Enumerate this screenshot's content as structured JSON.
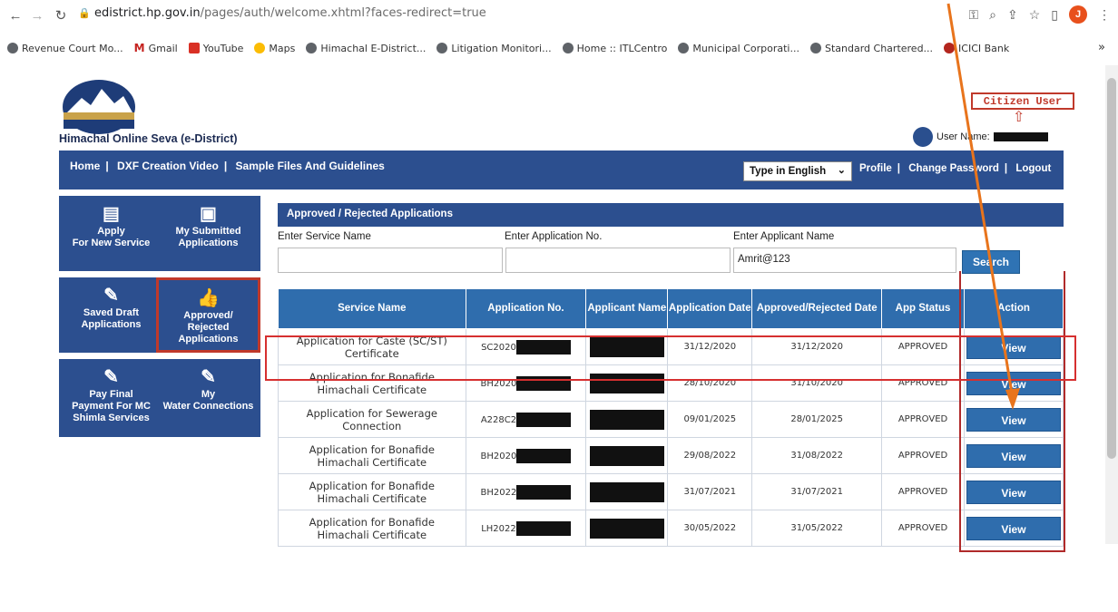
{
  "browser": {
    "url_host": "edistrict.hp.gov.in",
    "url_path": "/pages/auth/welcome.xhtml?faces-redirect=true",
    "profile_initial": "J",
    "bookmarks": [
      "Revenue Court Mo...",
      "Gmail",
      "YouTube",
      "Maps",
      "Himachal E-District...",
      "Litigation Monitori...",
      "Home :: ITLCentro",
      "Municipal Corporati...",
      "Standard Chartered...",
      "ICICI Bank"
    ],
    "more_bookmarks": "»"
  },
  "header": {
    "site_title": "Himachal Online Seva (e-District)",
    "citizen_label": "Citizen User",
    "user_label": "User Name:"
  },
  "nav": {
    "home": "Home",
    "dxf": "DXF Creation Video",
    "sample": "Sample Files And Guidelines",
    "language": "Type in English",
    "profile": "Profile",
    "change_password": "Change Password",
    "logout": "Logout"
  },
  "tiles": [
    {
      "l1": "Apply",
      "l2": "For New Service",
      "l3": ""
    },
    {
      "l1": "My Submitted",
      "l2": "Applications",
      "l3": ""
    },
    {
      "l1": "Saved Draft",
      "l2": "Applications",
      "l3": ""
    },
    {
      "l1": "Approved/",
      "l2": "Rejected Applications",
      "l3": ""
    },
    {
      "l1": "Pay Final",
      "l2": "Payment For MC",
      "l3": "Shimla Services"
    },
    {
      "l1": "My",
      "l2": "Water Connections",
      "l3": ""
    }
  ],
  "panel": {
    "title": "Approved / Rejected Applications",
    "service_label": "Enter Service Name",
    "appno_label": "Enter Application No.",
    "applicant_label": "Enter Applicant Name",
    "applicant_value": "Amrit@123",
    "search_label": "Search"
  },
  "table": {
    "headers": [
      "Service Name",
      "Application No.",
      "Applicant Name",
      "Application Date",
      "Approved/Rejected Date",
      "App Status",
      "Action"
    ],
    "rows": [
      {
        "svc1": "Application for Caste (SC/ST)",
        "svc2": "Certificate",
        "appno": "SC2020",
        "app_date": "31/12/2020",
        "appr_date": "31/12/2020",
        "status": "APPROVED",
        "action": "View"
      },
      {
        "svc1": "Application for Bonafide",
        "svc2": "Himachali Certificate",
        "appno": "BH2020",
        "app_date": "28/10/2020",
        "appr_date": "31/10/2020",
        "status": "APPROVED",
        "action": "View"
      },
      {
        "svc1": "Application  for Sewerage",
        "svc2": "Connection",
        "appno": "A228C2",
        "app_date": "09/01/2025",
        "appr_date": "28/01/2025",
        "status": "APPROVED",
        "action": "View"
      },
      {
        "svc1": "Application for Bonafide",
        "svc2": "Himachali Certificate",
        "appno": "BH2020",
        "app_date": "29/08/2022",
        "appr_date": "31/08/2022",
        "status": "APPROVED",
        "action": "View"
      },
      {
        "svc1": "Application for Bonafide",
        "svc2": "Himachali Certificate",
        "appno": "BH2022",
        "app_date": "31/07/2021",
        "appr_date": "31/07/2021",
        "status": "APPROVED",
        "action": "View"
      },
      {
        "svc1": "Application for Bonafide",
        "svc2": "Himachali Certificate",
        "appno": "LH2022",
        "app_date": "30/05/2022",
        "appr_date": "31/05/2022",
        "status": "APPROVED",
        "action": "View"
      }
    ]
  },
  "colors": {
    "nav_blue": "#2c4f8f",
    "header_blue": "#2f6dad",
    "highlight_red": "#d63030",
    "pointer_orange": "#e8741c"
  }
}
